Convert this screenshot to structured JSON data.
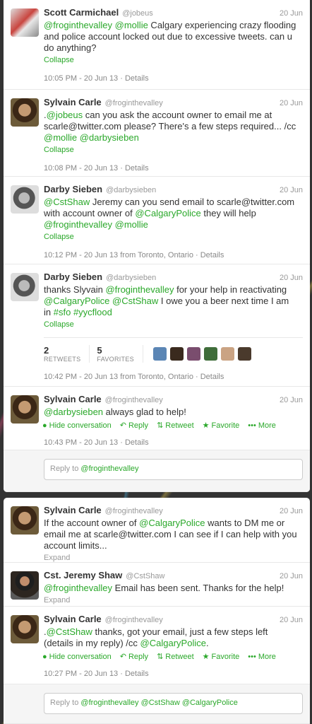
{
  "colors": {
    "link": "#2aa82a",
    "muted": "#999999",
    "text": "#333333"
  },
  "panel1": {
    "tweets": [
      {
        "name": "Scott Carmichael",
        "handle": "@jobeus",
        "time": "20 Jun",
        "mention1": "@frogintheValley",
        "mention2": "@mollie",
        "text_a": " Calgary experiencing crazy flooding and police account locked out due to excessive tweets. can u do anything?",
        "action": "Collapse",
        "meta": "10:05 PM - 20 Jun 13 · Details"
      },
      {
        "name": "Sylvain Carle",
        "handle": "@froginthevalley",
        "time": "20 Jun",
        "lead": ".",
        "mention1": "@jobeus",
        "text_a": " can you ask the account owner to email me at scarle@twitter.com please? There's a few steps required... /cc ",
        "mention2": "@mollie",
        "mention3": "@darbysieben",
        "action": "Collapse",
        "meta": "10:08 PM - 20 Jun 13 · Details"
      },
      {
        "name": "Darby Sieben",
        "handle": "@darbysieben",
        "time": "20 Jun",
        "mention1": "@CstShaw",
        "text_a": " Jeremy can you send email to scarle@twitter.com with account owner of ",
        "mention2": "@CalgaryPolice",
        "text_b": " they will help ",
        "mention3": "@froginthevalley",
        "mention4": "@mollie",
        "action": "Collapse",
        "meta": "10:12 PM - 20 Jun 13 from Toronto, Ontario · Details"
      },
      {
        "name": "Darby Sieben",
        "handle": "@darbysieben",
        "time": "20 Jun",
        "text_a": "thanks Slyvain ",
        "mention1": "@froginthevalley",
        "text_b": " for your help in reactivating ",
        "mention2": "@CalgaryPolice",
        "mention3": "@CstShaw",
        "text_c": " I owe you a beer next time I am in ",
        "hashtag1": "#sfo",
        "hashtag2": "#yycflood",
        "action": "Collapse",
        "retweets_num": "2",
        "retweets_label": "RETWEETS",
        "favorites_num": "5",
        "favorites_label": "FAVORITES",
        "meta": "10:42 PM - 20 Jun 13 from Toronto, Ontario · Details"
      },
      {
        "name": "Sylvain Carle",
        "handle": "@froginthevalley",
        "time": "20 Jun",
        "mention1": "@darbysieben",
        "text_a": " always glad to help!",
        "hide": "Hide conversation",
        "reply": "Reply",
        "retweet": "Retweet",
        "favorite": "Favorite",
        "more": "More",
        "meta": "10:43 PM - 20 Jun 13 · Details"
      }
    ],
    "reply_prefix": "Reply to ",
    "reply_mention": "@froginthevalley"
  },
  "panel2": {
    "tweets": [
      {
        "name": "Sylvain Carle",
        "handle": "@froginthevalley",
        "time": "20 Jun",
        "text_a": "If the account owner of ",
        "mention1": "@CalgaryPolice",
        "text_b": " wants to DM me or email me at scarle@twitter.com I can see if I can help with you account limits...",
        "action": "Expand"
      },
      {
        "name": "Cst. Jeremy Shaw",
        "handle": "@CstShaw",
        "time": "20 Jun",
        "mention1": "@froginthevalley",
        "text_a": " Email has been sent.  Thanks for the help!",
        "action": "Expand"
      },
      {
        "name": "Sylvain Carle",
        "handle": "@froginthevalley",
        "time": "20 Jun",
        "lead": ".",
        "mention1": "@CstShaw",
        "text_a": " thanks, got your email, just a few steps left (details in my reply) /cc ",
        "mention2": "@CalgaryPolice",
        "text_b": ".",
        "hide": "Hide conversation",
        "reply": "Reply",
        "retweet": "Retweet",
        "favorite": "Favorite",
        "more": "More",
        "meta": "10:27 PM - 20 Jun 13 · Details"
      }
    ],
    "reply_prefix": "Reply to ",
    "reply_mentions": "@froginthevalley @CstShaw @CalgaryPolice"
  }
}
